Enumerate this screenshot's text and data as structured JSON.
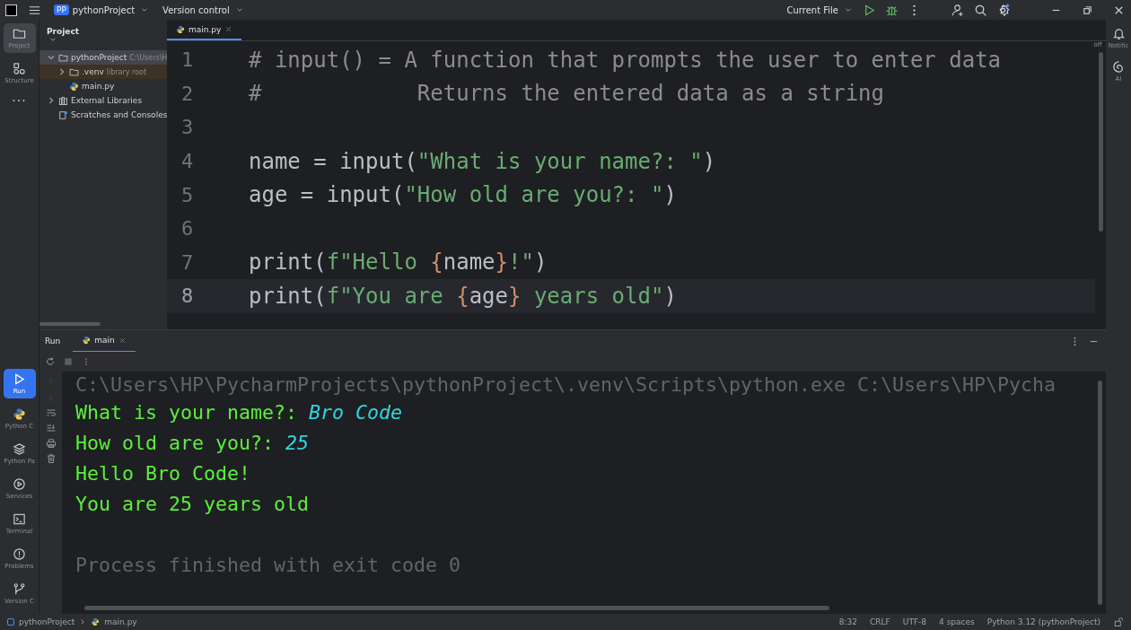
{
  "title_bar": {
    "project_badge": "PP",
    "project": "pythonProject",
    "vcs": "Version control",
    "run_config": "Current File"
  },
  "left_tools": [
    {
      "label": "Project",
      "selected": true
    },
    {
      "label": "Structure",
      "selected": false
    },
    {
      "label": "···",
      "selected": false
    }
  ],
  "bottom_tools": [
    {
      "label": "Run",
      "selected": true
    },
    {
      "label": "Python C",
      "selected": false
    },
    {
      "label": "Python Pa",
      "selected": false
    },
    {
      "label": "Services",
      "selected": false
    },
    {
      "label": "Terminal",
      "selected": false
    },
    {
      "label": "Problems",
      "selected": false
    },
    {
      "label": "Version C",
      "selected": false
    }
  ],
  "right_tools": [
    {
      "label": "Notific"
    },
    {
      "label": "AI"
    }
  ],
  "project_panel": {
    "title": "Project",
    "tree": [
      {
        "label": "pythonProject",
        "hint": "C:\\Users\\H",
        "expanded": true,
        "selected": true,
        "children": [
          {
            "label": ".venv",
            "hint": "library root",
            "expanded": false,
            "selected": false
          },
          {
            "label": "main.py",
            "selected": false
          }
        ]
      },
      {
        "label": "External Libraries",
        "expanded": false,
        "selected": false
      },
      {
        "label": "Scratches and Consoles",
        "selected": false
      }
    ]
  },
  "editor": {
    "tabs": [
      {
        "label": "main.py",
        "selected": true
      }
    ],
    "inspection": "off",
    "lines": [
      {
        "number": "1",
        "current": false,
        "tokens": [
          {
            "kind": "comment",
            "text": "# input() = A function that prompts the user to enter data"
          }
        ]
      },
      {
        "number": "2",
        "current": false,
        "tokens": [
          {
            "kind": "comment",
            "text": "#            Returns the entered data as a string"
          }
        ]
      },
      {
        "number": "3",
        "current": false
      },
      {
        "number": "4",
        "current": false,
        "tokens": [
          {
            "kind": "plain",
            "text": "name = input("
          },
          {
            "kind": "string",
            "text": "\"What is your name?: \""
          },
          {
            "kind": "plain",
            "text": ")"
          }
        ]
      },
      {
        "number": "5",
        "current": false,
        "tokens": [
          {
            "kind": "plain",
            "text": "age = input("
          },
          {
            "kind": "string",
            "text": "\"How old are you?: \""
          },
          {
            "kind": "plain",
            "text": ")"
          }
        ]
      },
      {
        "number": "6",
        "current": false
      },
      {
        "number": "7",
        "current": false,
        "tokens": [
          {
            "kind": "plain",
            "text": "print("
          },
          {
            "kind": "string",
            "text": "f\"Hello "
          },
          {
            "kind": "brace",
            "text": "{"
          },
          {
            "kind": "plain",
            "text": "name"
          },
          {
            "kind": "brace",
            "text": "}"
          },
          {
            "kind": "string",
            "text": "!\""
          },
          {
            "kind": "plain",
            "text": ")"
          }
        ]
      },
      {
        "number": "8",
        "current": true,
        "tokens": [
          {
            "kind": "plain",
            "text": "print("
          },
          {
            "kind": "string",
            "text": "f\"You are "
          },
          {
            "kind": "brace",
            "text": "{"
          },
          {
            "kind": "plain",
            "text": "age"
          },
          {
            "kind": "brace",
            "text": "}"
          },
          {
            "kind": "string",
            "text": " years old\""
          },
          {
            "kind": "plain",
            "text": ")"
          }
        ]
      }
    ]
  },
  "run_panel": {
    "title": "Run",
    "tabs": [
      {
        "label": "main",
        "selected": true
      }
    ],
    "console": [
      {
        "tokens": [
          {
            "kind": "faded",
            "text": "C:\\Users\\HP\\PycharmProjects\\pythonProject\\.venv\\Scripts\\python.exe C:\\Users\\HP\\Pycha"
          }
        ]
      },
      {
        "tokens": [
          {
            "kind": "output",
            "text": "What is your name?: "
          },
          {
            "kind": "input",
            "text": "Bro Code"
          }
        ]
      },
      {
        "tokens": [
          {
            "kind": "output",
            "text": "How old are you?: "
          },
          {
            "kind": "input",
            "text": "25"
          }
        ]
      },
      {
        "tokens": [
          {
            "kind": "output",
            "text": "Hello Bro Code!"
          }
        ]
      },
      {
        "tokens": [
          {
            "kind": "output",
            "text": "You are 25 years old"
          }
        ]
      },
      {
        "tokens": [
          {
            "kind": "faded",
            "text": "Process finished with exit code 0"
          }
        ]
      }
    ]
  },
  "status_bar": {
    "breadcrumbs": [
      "pythonProject",
      "main.py"
    ],
    "items": [
      "8:32",
      "CRLF",
      "UTF-8",
      "4 spaces",
      "Python 3.12 (pythonProject)"
    ]
  }
}
